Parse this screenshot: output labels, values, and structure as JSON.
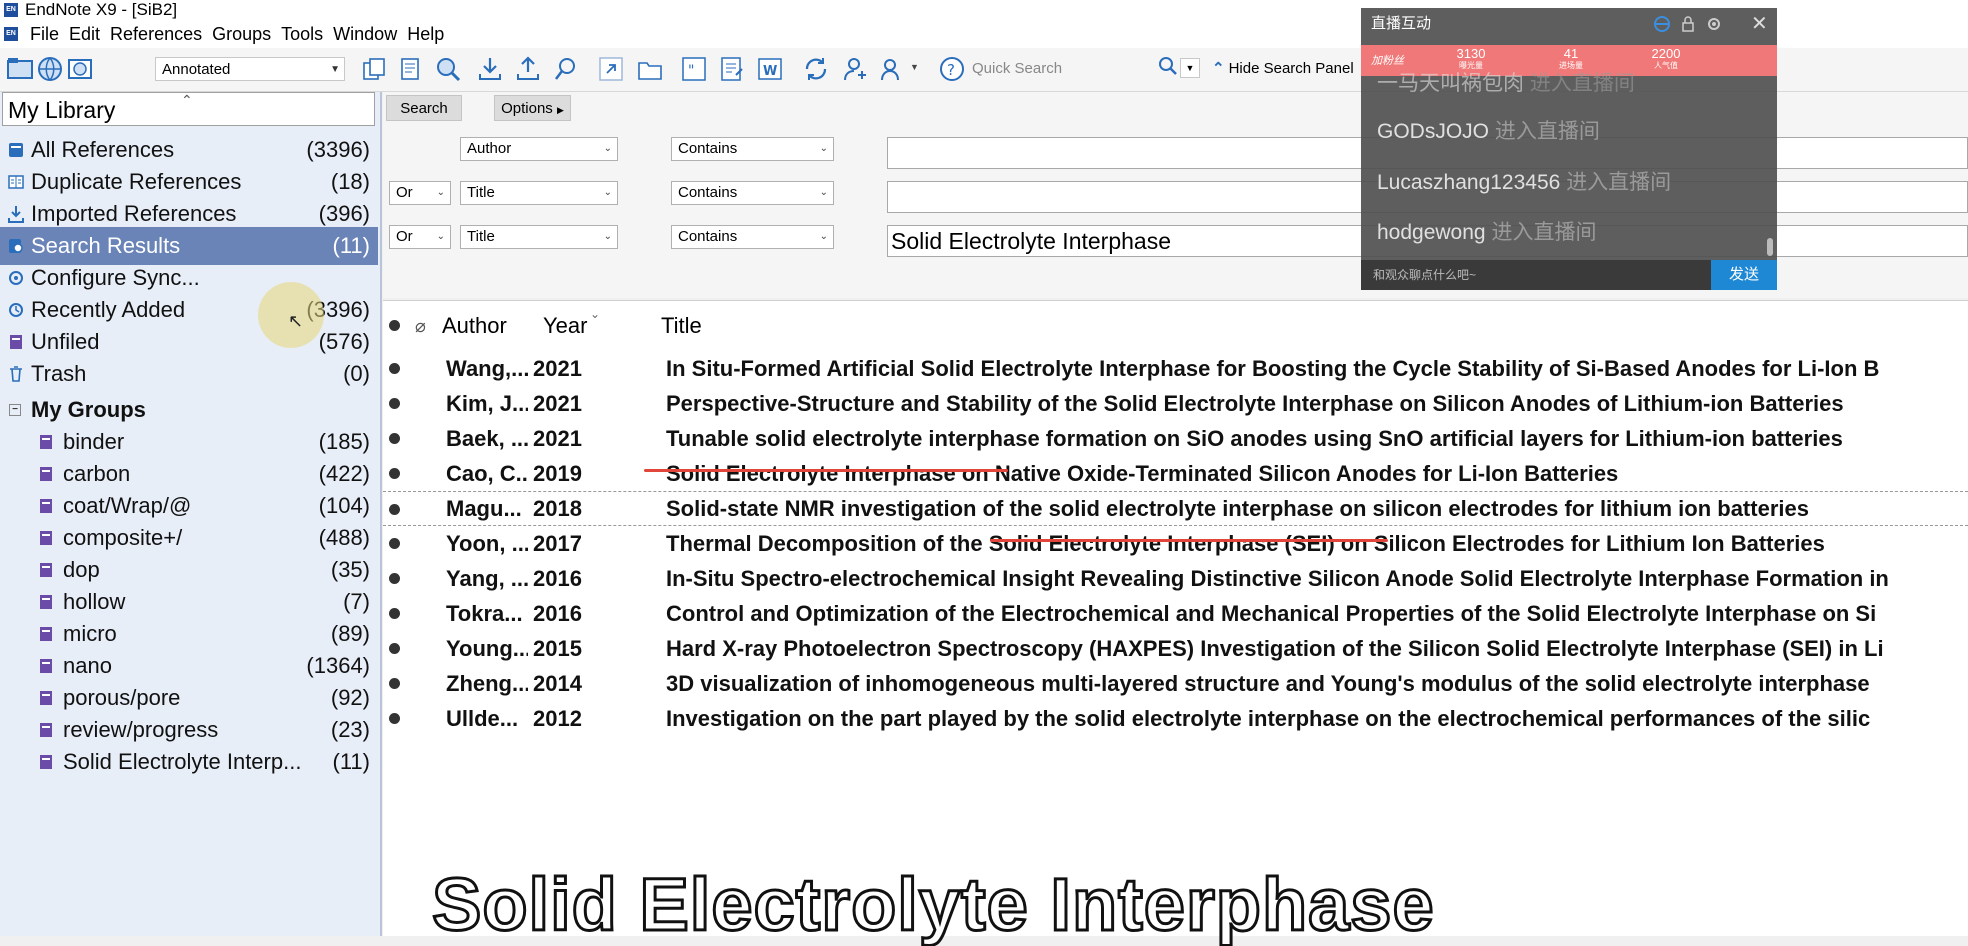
{
  "window": {
    "title": "EndNote X9 - [SiB2]",
    "app_badge": "EN"
  },
  "menu": [
    "File",
    "Edit",
    "References",
    "Groups",
    "Tools",
    "Window",
    "Help"
  ],
  "toolbar": {
    "style_value": "Annotated",
    "quick_search_placeholder": "Quick Search",
    "hide_search_panel": "Hide Search Panel"
  },
  "sidebar": {
    "library_label": "My Library",
    "items": [
      {
        "label": "All References",
        "count": "(3396)",
        "icon": "library-icon"
      },
      {
        "label": "Duplicate References",
        "count": "(18)",
        "icon": "duplicate-icon"
      },
      {
        "label": "Imported References",
        "count": "(396)",
        "icon": "import-icon"
      },
      {
        "label": "Search Results",
        "count": "(11)",
        "icon": "search-results-icon"
      },
      {
        "label": "Configure Sync...",
        "count": "",
        "icon": "sync-icon"
      },
      {
        "label": "Recently Added",
        "count": "(3396)",
        "icon": "clock-icon"
      },
      {
        "label": "Unfiled",
        "count": "(576)",
        "icon": "unfiled-icon"
      },
      {
        "label": "Trash",
        "count": "(0)",
        "icon": "trash-icon"
      }
    ],
    "my_groups_label": "My Groups",
    "groups": [
      {
        "label": "binder",
        "count": "(185)"
      },
      {
        "label": "carbon",
        "count": "(422)"
      },
      {
        "label": "coat/Wrap/@",
        "count": "(104)"
      },
      {
        "label": "composite+/",
        "count": "(488)"
      },
      {
        "label": "dop",
        "count": "(35)"
      },
      {
        "label": "hollow",
        "count": "(7)"
      },
      {
        "label": "micro",
        "count": "(89)"
      },
      {
        "label": "nano",
        "count": "(1364)"
      },
      {
        "label": "porous/pore",
        "count": "(92)"
      },
      {
        "label": "review/progress",
        "count": "(23)"
      },
      {
        "label": "Solid Electrolyte Interp...",
        "count": "(11)"
      }
    ]
  },
  "search_panel": {
    "search_button": "Search",
    "options_button": "Options",
    "rows": [
      {
        "bool": "",
        "field": "Author",
        "op": "Contains",
        "value": ""
      },
      {
        "bool": "Or",
        "field": "Title",
        "op": "Contains",
        "value": ""
      },
      {
        "bool": "Or",
        "field": "Title",
        "op": "Contains",
        "value": "Solid Electrolyte Interphase"
      }
    ]
  },
  "references": {
    "columns": {
      "author": "Author",
      "year": "Year",
      "title": "Title"
    },
    "rows": [
      {
        "author": "Wang,...",
        "year": "2021",
        "title": "In Situ-Formed Artificial Solid Electrolyte Interphase for Boosting the Cycle Stability of Si-Based Anodes for Li-Ion B"
      },
      {
        "author": "Kim, J...",
        "year": "2021",
        "title": "Perspective-Structure and Stability of the Solid Electrolyte Interphase on Silicon Anodes of Lithium-ion Batteries"
      },
      {
        "author": "Baek, ...",
        "year": "2021",
        "title": "Tunable solid electrolyte interphase formation on SiO anodes using SnO artificial layers for Lithium-ion batteries"
      },
      {
        "author": "Cao, C...",
        "year": "2019",
        "title": "Solid Electrolyte Interphase on Native Oxide-Terminated Silicon Anodes for Li-Ion Batteries"
      },
      {
        "author": "Magu...",
        "year": "2018",
        "title": "Solid-state NMR investigation of the solid electrolyte interphase on silicon electrodes for lithium ion batteries"
      },
      {
        "author": "Yoon, ...",
        "year": "2017",
        "title": "Thermal Decomposition of the Solid Electrolyte Interphase (SEI) on Silicon Electrodes for Lithium Ion Batteries"
      },
      {
        "author": "Yang, ...",
        "year": "2016",
        "title": "In-Situ Spectro-electrochemical Insight Revealing Distinctive Silicon Anode Solid Electrolyte Interphase Formation in"
      },
      {
        "author": "Tokra...",
        "year": "2016",
        "title": "Control and Optimization of the Electrochemical and Mechanical Properties of the Solid Electrolyte Interphase on Si"
      },
      {
        "author": "Young...",
        "year": "2015",
        "title": "Hard X-ray Photoelectron Spectroscopy (HAXPES) Investigation of the Silicon Solid Electrolyte Interphase (SEI) in Li"
      },
      {
        "author": "Zheng...",
        "year": "2014",
        "title": "3D visualization of inhomogeneous multi-layered structure and Young's modulus of the solid electrolyte interphase"
      },
      {
        "author": "Ullde...",
        "year": "2012",
        "title": "Investigation on the part played by the solid electrolyte interphase on the electrochemical performances of the silic"
      }
    ]
  },
  "caption": "Solid Electrolyte Interphase",
  "live_panel": {
    "title": "直播互动",
    "badge": "加粉丝",
    "stats": [
      {
        "value": "3130",
        "label": "曝光量"
      },
      {
        "value": "41",
        "label": "进场量"
      },
      {
        "value": "2200",
        "label": "人气值"
      }
    ],
    "messages": [
      {
        "user": "一马天叫祸包肉",
        "action": "进入直播间"
      },
      {
        "user": "GODsJOJO",
        "action": "进入直播间"
      },
      {
        "user": "Lucaszhang123456",
        "action": "进入直播间"
      },
      {
        "user": "hodgewong",
        "action": "进入直播间"
      }
    ],
    "input_placeholder": "和观众聊点什么吧~",
    "send_label": "发送"
  },
  "colors": {
    "selection": "#6a84b8",
    "sidebar_bg": "#e8eef8",
    "annotation_red": "#e2453a",
    "live_send": "#1e88d4"
  }
}
